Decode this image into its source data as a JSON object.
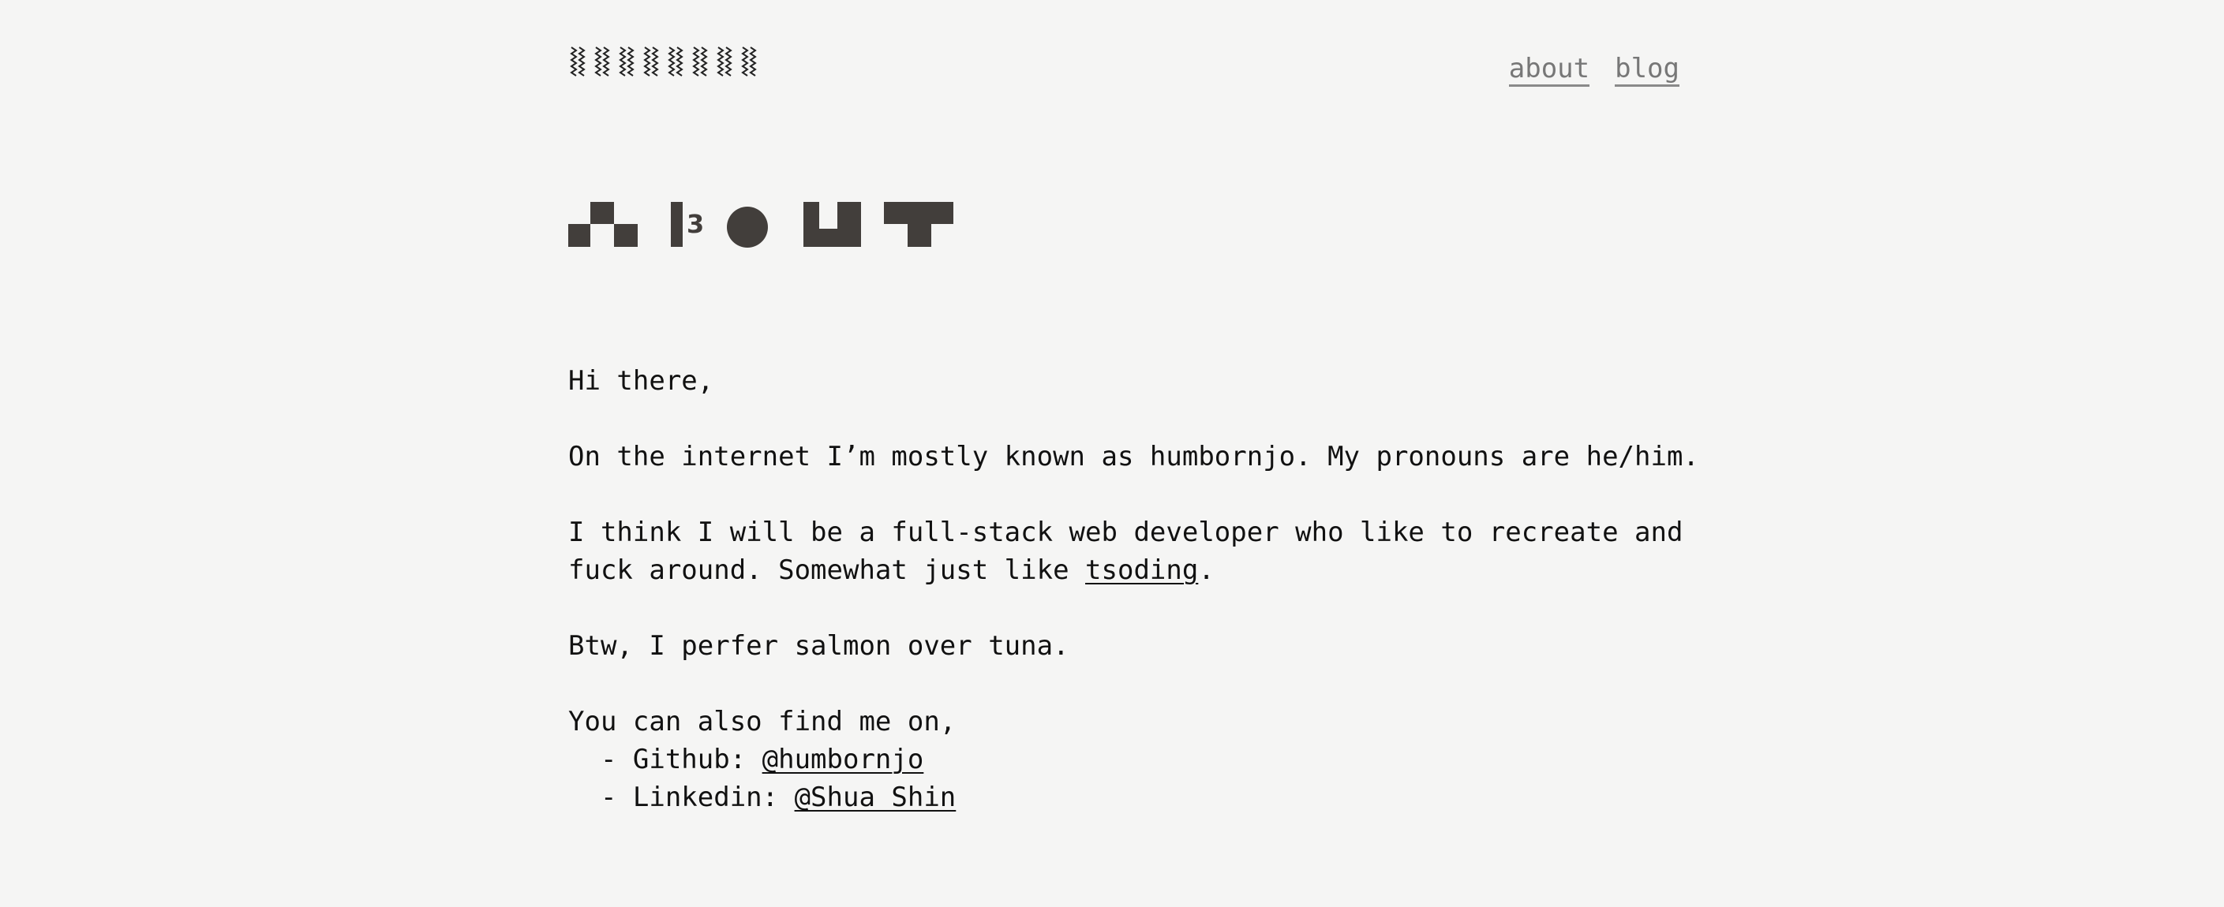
{
  "header": {
    "logo_alt": "site logo",
    "nav": [
      {
        "label": "about"
      },
      {
        "label": "blog"
      }
    ]
  },
  "title": {
    "text": "about",
    "accent": "#423e3b",
    "superscript": "3"
  },
  "content": {
    "greeting": "Hi there,",
    "intro": "On the internet I’m mostly known as humbornjo. My pronouns are he/him.",
    "dev_line_1": "I think I will be a full-stack web developer who like to recreate and",
    "dev_line_2_before": "fuck around. Somewhat just like ",
    "dev_line_2_link": "tsoding",
    "dev_line_2_after": ".",
    "food_line": "Btw, I perfer salmon over tuna.",
    "contact_intro": "You can also find me on,",
    "socials": [
      {
        "label": "  - Github: ",
        "handle": "@humbornjo"
      },
      {
        "label": "  - Linkedin: ",
        "handle": "@Shua Shin"
      }
    ]
  }
}
